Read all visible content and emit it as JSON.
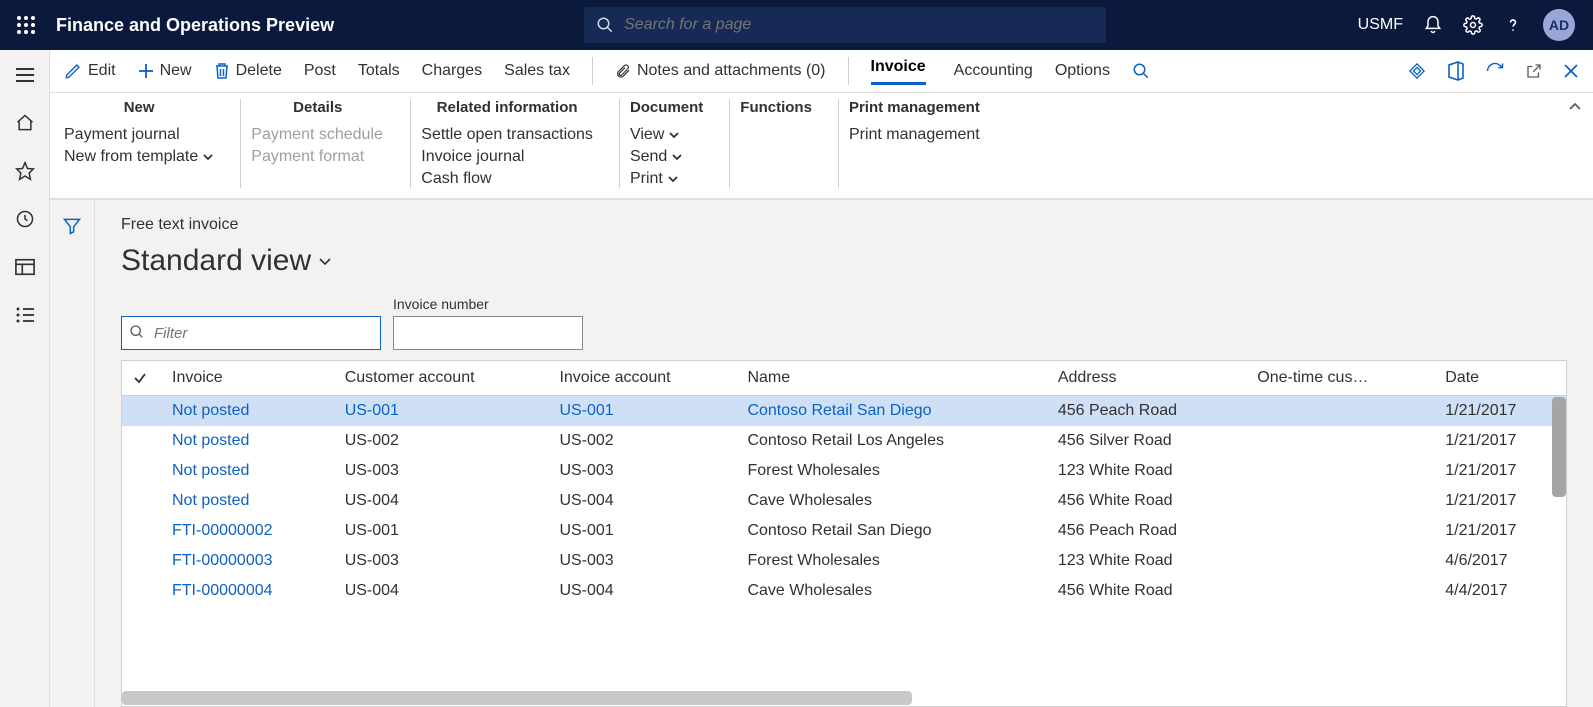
{
  "header": {
    "app_title": "Finance and Operations Preview",
    "search_placeholder": "Search for a page",
    "entity": "USMF",
    "avatar": "AD"
  },
  "actionbar": {
    "edit": "Edit",
    "new": "New",
    "delete": "Delete",
    "post": "Post",
    "totals": "Totals",
    "charges": "Charges",
    "salestax": "Sales tax",
    "notes": "Notes and attachments (0)",
    "invoice": "Invoice",
    "accounting": "Accounting",
    "options": "Options"
  },
  "ribbon": {
    "groups": {
      "new": {
        "title": "New",
        "items": [
          "Payment journal",
          "New from template"
        ]
      },
      "details": {
        "title": "Details",
        "items": [
          "Payment schedule",
          "Payment format"
        ]
      },
      "related": {
        "title": "Related information",
        "items": [
          "Settle open transactions",
          "Invoice journal",
          "Cash flow"
        ]
      },
      "document": {
        "title": "Document",
        "items": [
          "View",
          "Send",
          "Print"
        ]
      },
      "functions": {
        "title": "Functions",
        "items": []
      },
      "printmgmt": {
        "title": "Print management",
        "items": [
          "Print management"
        ]
      }
    }
  },
  "page": {
    "breadcrumb": "Free text invoice",
    "view_title": "Standard view",
    "filter_placeholder": "Filter",
    "invoice_number_label": "Invoice number",
    "invoice_number_value": ""
  },
  "grid": {
    "columns": [
      "Invoice",
      "Customer account",
      "Invoice account",
      "Name",
      "Address",
      "One-time cus…",
      "Date"
    ],
    "rows": [
      {
        "invoice": "Not posted",
        "custacct": "US-001",
        "invacct": "US-001",
        "name": "Contoso Retail San Diego",
        "address": "456 Peach Road",
        "onetime": "",
        "date": "1/21/2017",
        "selected": true,
        "link_cols": [
          "invoice",
          "custacct",
          "invacct",
          "name"
        ]
      },
      {
        "invoice": "Not posted",
        "custacct": "US-002",
        "invacct": "US-002",
        "name": "Contoso Retail Los Angeles",
        "address": "456 Silver Road",
        "onetime": "",
        "date": "1/21/2017",
        "selected": false,
        "link_cols": [
          "invoice"
        ]
      },
      {
        "invoice": "Not posted",
        "custacct": "US-003",
        "invacct": "US-003",
        "name": "Forest Wholesales",
        "address": "123 White Road",
        "onetime": "",
        "date": "1/21/2017",
        "selected": false,
        "link_cols": [
          "invoice"
        ]
      },
      {
        "invoice": "Not posted",
        "custacct": "US-004",
        "invacct": "US-004",
        "name": "Cave Wholesales",
        "address": "456 White Road",
        "onetime": "",
        "date": "1/21/2017",
        "selected": false,
        "link_cols": [
          "invoice"
        ]
      },
      {
        "invoice": "FTI-00000002",
        "custacct": "US-001",
        "invacct": "US-001",
        "name": "Contoso Retail San Diego",
        "address": "456 Peach Road",
        "onetime": "",
        "date": "1/21/2017",
        "selected": false,
        "link_cols": [
          "invoice"
        ]
      },
      {
        "invoice": "FTI-00000003",
        "custacct": "US-003",
        "invacct": "US-003",
        "name": "Forest Wholesales",
        "address": "123 White Road",
        "onetime": "",
        "date": "4/6/2017",
        "selected": false,
        "link_cols": [
          "invoice"
        ]
      },
      {
        "invoice": "FTI-00000004",
        "custacct": "US-004",
        "invacct": "US-004",
        "name": "Cave Wholesales",
        "address": "456 White Road",
        "onetime": "",
        "date": "4/4/2017",
        "selected": false,
        "link_cols": [
          "invoice"
        ]
      }
    ]
  }
}
